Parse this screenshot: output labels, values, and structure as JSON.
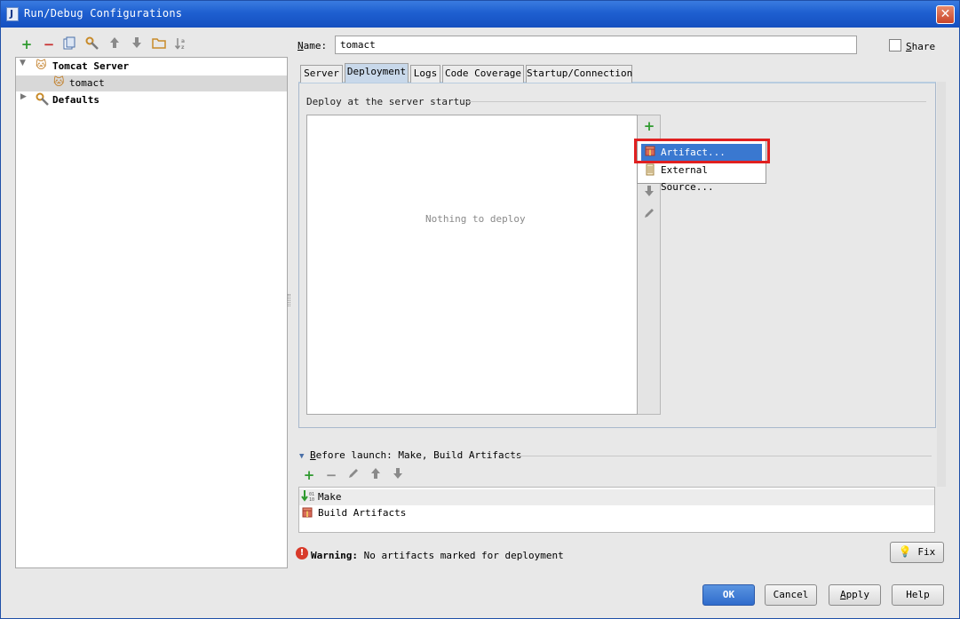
{
  "window": {
    "title": "Run/Debug Configurations",
    "icon_letter": "J",
    "close_glyph": "✕"
  },
  "left_toolbar": {
    "icons": [
      "add-icon",
      "remove-icon",
      "copy-icon",
      "edit-defaults-icon",
      "move-up-icon",
      "move-down-icon",
      "folder-icon",
      "sort-icon"
    ]
  },
  "tree": {
    "items": [
      {
        "label": "Tomcat Server",
        "expanded": true
      },
      {
        "label": "tomact",
        "selected": true
      },
      {
        "label": "Defaults",
        "expanded": false
      }
    ]
  },
  "form": {
    "name_label_first": "N",
    "name_label_rest": "ame:",
    "name_value": "tomact",
    "share_first": "S",
    "share_rest": "hare"
  },
  "tabs": [
    {
      "label": "Server"
    },
    {
      "label": "Deployment",
      "active": true
    },
    {
      "label": "Logs"
    },
    {
      "label": "Code Coverage"
    },
    {
      "label": "Startup/Connection"
    }
  ],
  "deploy": {
    "section_title": "Deploy at the server startup",
    "empty_text": "Nothing to deploy"
  },
  "popup_menu": {
    "items": [
      {
        "label": "Artifact...",
        "highlighted": true
      },
      {
        "label": "External Source..."
      }
    ]
  },
  "before_launch": {
    "title_first": "B",
    "title_rest": "efore launch: Make, Build Artifacts",
    "items": [
      {
        "label": "Make",
        "selected": true
      },
      {
        "label": "Build Artifacts"
      }
    ]
  },
  "warning": {
    "label": "Warning:",
    "text": "No artifacts marked for deployment"
  },
  "buttons": {
    "fix": "Fix",
    "ok": "OK",
    "cancel": "Cancel",
    "apply_first": "A",
    "apply_rest": "pply",
    "help": "Help"
  },
  "colors": {
    "title_bar": "#1e5fd0",
    "selection": "#3a78d0",
    "highlight_box": "#e02020",
    "add_green": "#2f9a2f",
    "remove_red": "#c83030"
  }
}
